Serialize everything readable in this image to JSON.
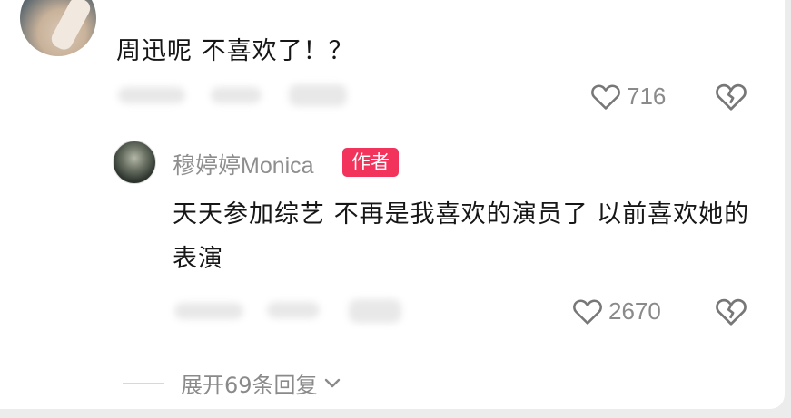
{
  "top_comment": {
    "text": "周迅呢 不喜欢了！？",
    "like_count": "716"
  },
  "reply": {
    "author_name": "穆婷婷Monica",
    "author_badge": "作者",
    "text": "天天参加综艺 不再是我喜欢的演员了 以前喜欢她的表演",
    "like_count": "2670"
  },
  "expand_replies": {
    "label": "展开69条回复"
  },
  "icons": {
    "like": "heart-outline-icon",
    "dislike": "broken-heart-icon",
    "expand": "chevron-down-icon"
  },
  "colors": {
    "badge_bg": "#f2335b",
    "text_primary": "#161616",
    "text_secondary": "#8a8a8a"
  }
}
